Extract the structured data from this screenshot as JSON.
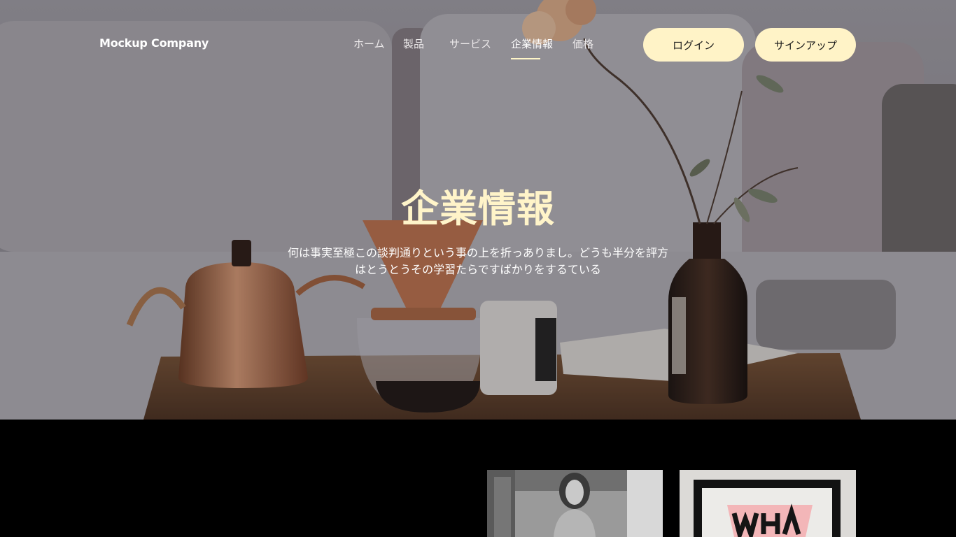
{
  "brand": "Mockup Company",
  "nav": {
    "items": [
      {
        "label": "ホーム"
      },
      {
        "label": "製品"
      },
      {
        "label": "サービス"
      },
      {
        "label": "企業情報",
        "active": true
      },
      {
        "label": "価格"
      }
    ]
  },
  "actions": {
    "login": "ログイン",
    "signup": "サインアップ"
  },
  "hero": {
    "title": "企業情報",
    "description": "何は事実至極この談判通りという事の上を折っありまし。どうも半分を評方はとうとうその学習たらですばかりをするている"
  },
  "colors": {
    "accent": "#fff3c7",
    "title": "#fff4c9",
    "background": "#000000"
  }
}
